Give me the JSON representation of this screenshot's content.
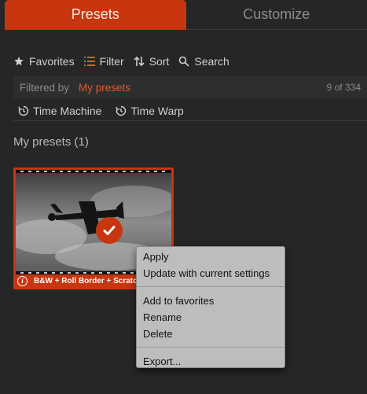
{
  "tabs": [
    {
      "label": "Presets",
      "active": true
    },
    {
      "label": "Customize",
      "active": false
    }
  ],
  "toolbar": {
    "favorites": "Favorites",
    "filter": "Filter",
    "sort": "Sort",
    "search": "Search"
  },
  "filterbar": {
    "label": "Filtered by",
    "value": "My presets",
    "count": "9 of 334"
  },
  "chips": {
    "time_machine": "Time Machine",
    "time_warp": "Time Warp"
  },
  "section": {
    "title": "My presets (1)"
  },
  "preset": {
    "caption": "B&W + Roll Border + Scratch",
    "info_glyph": "i"
  },
  "context_menu": {
    "apply": "Apply",
    "update": "Update with current settings",
    "add_favorites": "Add to favorites",
    "rename": "Rename",
    "delete": "Delete",
    "export": "Export..."
  },
  "colors": {
    "accent": "#c8360f",
    "accent_text": "#e15a2c",
    "background": "#262626",
    "menu_bg": "#bdbdbd"
  },
  "icons": [
    "star-icon",
    "filter-list-icon",
    "sort-arrows-icon",
    "search-icon",
    "timer-icon",
    "check-icon",
    "info-icon"
  ]
}
